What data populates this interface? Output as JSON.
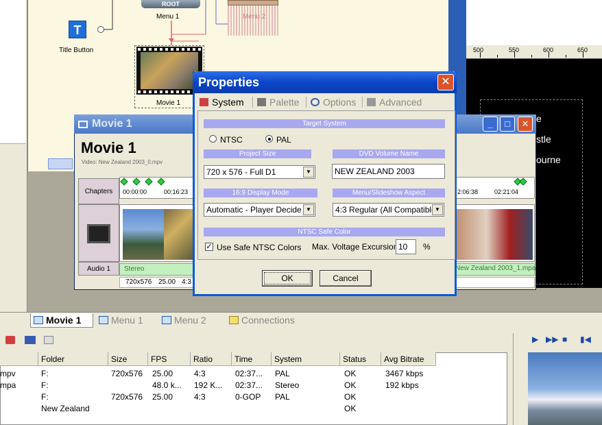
{
  "menu_editor": {
    "root_label": "ROOT",
    "menu1_label": "Menu 1",
    "menu2_label": "Menu 2",
    "title_button_icon": "T",
    "title_button_label": "Title Button",
    "movie_thumb_label": "Movie 1"
  },
  "preview": {
    "ruler": [
      "500",
      "550",
      "600",
      "650"
    ],
    "text_lines": [
      "e",
      "stle",
      "ourne"
    ]
  },
  "movie_window": {
    "title": "Movie 1",
    "heading": "Movie 1",
    "subtitle": "Video: New Zealand 2003_0.mpv",
    "chapters_label": "Chapters",
    "audio_label": "Audio 1",
    "times": [
      "00:00:00",
      "00:16:23",
      "2:06:38",
      "02:21:04"
    ],
    "audio_left": "Stereo",
    "audio_right": "New Zealand 2003_1.mpa",
    "info": [
      "720x576",
      "25.00",
      "4:3"
    ]
  },
  "bottom_tabs": [
    {
      "label": "Movie 1"
    },
    {
      "label": "Menu 1"
    },
    {
      "label": "Menu 2"
    },
    {
      "label": "Connections"
    }
  ],
  "asset_list": {
    "columns": [
      "Folder",
      "Size",
      "FPS",
      "Ratio",
      "Time",
      "System",
      "Status",
      "Avg Bitrate"
    ],
    "rows": [
      {
        "name": "mpv",
        "folder": "F:",
        "size": "720x576",
        "fps": "25.00",
        "ratio": "4:3",
        "time": "02:37...",
        "system": "PAL",
        "status": "OK",
        "bitrate": "3467 kbps"
      },
      {
        "name": "mpa",
        "folder": "F:",
        "size": "",
        "fps": "48.0 k...",
        "ratio": "192 K...",
        "time": "02:37...",
        "system": "Stereo",
        "status": "OK",
        "bitrate": "192 kbps"
      },
      {
        "name": "",
        "folder": "F:",
        "size": "720x576",
        "fps": "25.00",
        "ratio": "4:3",
        "time": "0-GOP",
        "system": "PAL",
        "status": "OK",
        "bitrate": ""
      },
      {
        "name": "",
        "folder": "New Zealand",
        "size": "",
        "fps": "",
        "ratio": "",
        "time": "",
        "system": "",
        "status": "OK",
        "bitrate": ""
      }
    ]
  },
  "dialog": {
    "title": "Properties",
    "close": "✕",
    "tabs": [
      "System",
      "Palette",
      "Options",
      "Advanced"
    ],
    "target_system_header": "Target System",
    "ntsc_label": "NTSC",
    "pal_label": "PAL",
    "selected_system": "PAL",
    "project_size_header": "Project Size",
    "project_size_value": "720 x 576 - Full D1",
    "dvd_volume_header": "DVD Volume Name",
    "dvd_volume_value": "NEW ZEALAND 2003",
    "display_mode_header": "16:9 Display Mode",
    "display_mode_value": "Automatic - Player Decide",
    "aspect_header": "Menu/Slideshow Aspect",
    "aspect_value": "4:3  Regular (All Compatible)",
    "safe_color_header": "NTSC Safe Color",
    "use_safe_label": "Use Safe NTSC Colors",
    "use_safe_checked": true,
    "max_voltage_label": "Max. Voltage Excursion",
    "max_voltage_value": "10",
    "percent": "%",
    "ok_label": "OK",
    "cancel_label": "Cancel"
  },
  "colors": {
    "titlebar": "#0a46c8",
    "section_header": "#a8a8f0",
    "close_button": "#d9542b"
  }
}
